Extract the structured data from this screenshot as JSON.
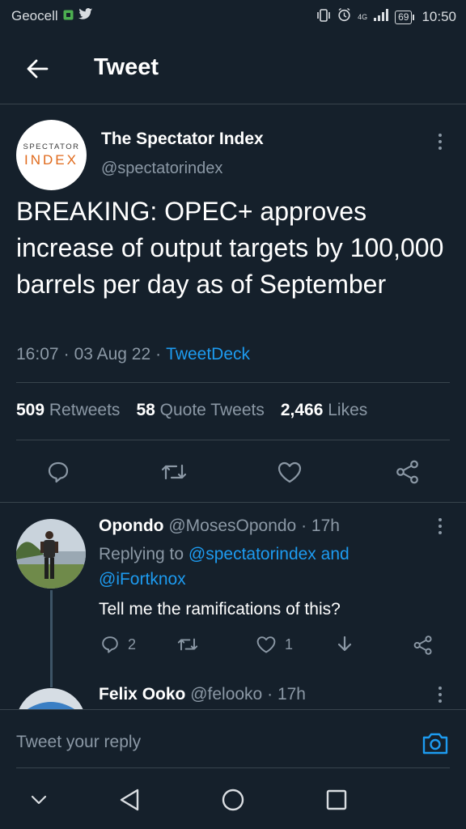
{
  "status_bar": {
    "carrier": "Geocell",
    "network": "4G",
    "battery": "69",
    "time": "10:50"
  },
  "header": {
    "title": "Tweet",
    "back_icon": "arrow-left-icon"
  },
  "main_tweet": {
    "avatar_line1": "SPECTATOR",
    "avatar_line2": "INDEX",
    "author_name": "The Spectator Index",
    "author_handle": "@spectatorindex",
    "text": "BREAKING: OPEC+ approves increase of output targets by 100,000 barrels per day as of September",
    "time": "16:07",
    "date": "03 Aug 22",
    "separator": "·",
    "source": "TweetDeck",
    "stats": {
      "retweets": "509",
      "retweets_label": "Retweets",
      "quote_tweets": "58",
      "quote_tweets_label": "Quote Tweets",
      "likes": "2,466",
      "likes_label": "Likes"
    },
    "actions": [
      "reply-icon",
      "retweet-icon",
      "like-icon",
      "share-icon"
    ]
  },
  "replies": [
    {
      "name": "Opondo",
      "handle": "@MosesOpondo",
      "separator": "·",
      "age": "17h",
      "replying_prefix": "Replying to",
      "mention_1": "@spectatorindex",
      "conjunction": "and",
      "mention_2": "@iFortknox",
      "text": "Tell me the ramifications of this?",
      "reply_count": "2",
      "like_count": "1"
    },
    {
      "name": "Felix Ooko",
      "handle": "@felooko",
      "separator": "·",
      "age": "17h"
    }
  ],
  "reply_bar": {
    "placeholder": "Tweet your reply"
  },
  "colors": {
    "background": "#15202b",
    "accent": "#1d9bf0",
    "secondary_text": "#8b98a5",
    "divider": "#38444d"
  }
}
